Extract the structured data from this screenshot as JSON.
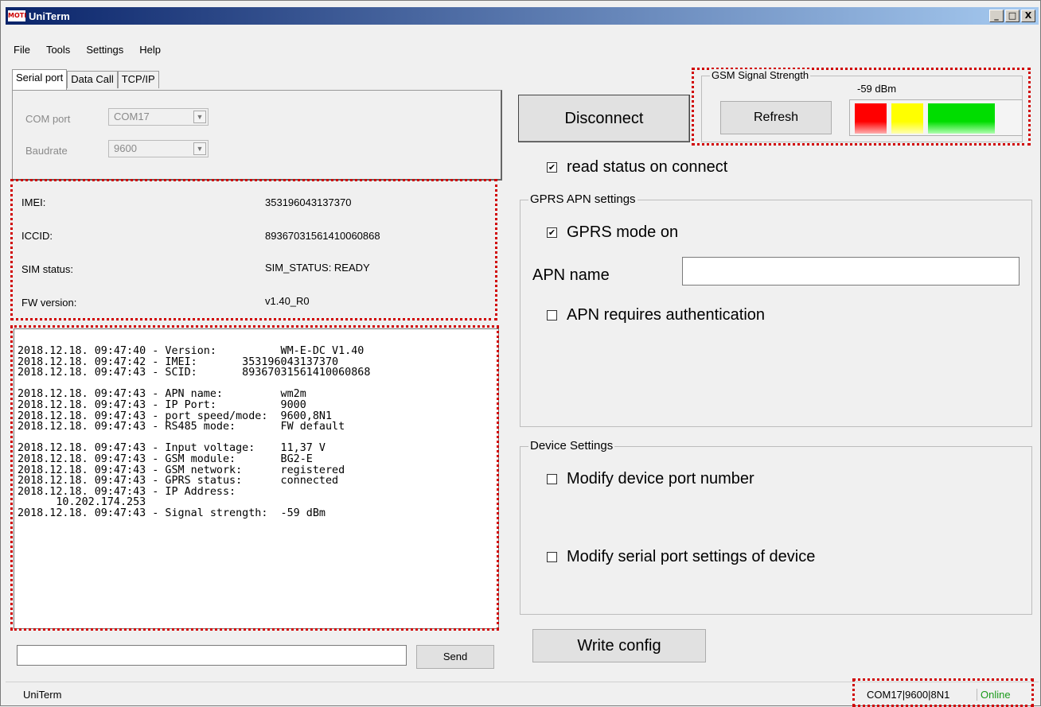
{
  "window": {
    "title": "UniTerm",
    "app_icon": "MOTI",
    "minimize": "_",
    "maximize": "□",
    "close": "X"
  },
  "menu": [
    "File",
    "Tools",
    "Settings",
    "Help"
  ],
  "tabs": [
    "Serial port",
    "Data Call",
    "TCP/IP"
  ],
  "serial": {
    "com_label": "COM port",
    "com_value": "COM17",
    "baud_label": "Baudrate",
    "baud_value": "9600"
  },
  "device_info": {
    "imei_label": "IMEI:",
    "imei": "353196043137370",
    "iccid_label": "ICCID:",
    "iccid": "89367031561410060868",
    "sim_label": "SIM status:",
    "sim": "SIM_STATUS: READY",
    "fw_label": "FW version:",
    "fw": "v1.40_R0"
  },
  "log_lines": [
    "2018.12.18. 09:47:40 - Version:          WM-E-DC V1.40",
    "2018.12.18. 09:47:42 - IMEI:       353196043137370",
    "2018.12.18. 09:47:43 - SCID:       89367031561410060868",
    "",
    "2018.12.18. 09:47:43 - APN name:         wm2m",
    "2018.12.18. 09:47:43 - IP Port:          9000",
    "2018.12.18. 09:47:43 - port speed/mode:  9600,8N1",
    "2018.12.18. 09:47:43 - RS485 mode:       FW default",
    "",
    "2018.12.18. 09:47:43 - Input voltage:    11,37 V",
    "2018.12.18. 09:47:43 - GSM module:       BG2-E",
    "2018.12.18. 09:47:43 - GSM network:      registered",
    "2018.12.18. 09:47:43 - GPRS status:      connected",
    "2018.12.18. 09:47:43 - IP Address:",
    "      10.202.174.253",
    "2018.12.18. 09:47:43 - Signal strength:  -59 dBm"
  ],
  "send_label": "Send",
  "disconnect_label": "Disconnect",
  "gsm": {
    "title": "GSM Signal Strength",
    "dbm": "-59 dBm",
    "refresh_label": "Refresh",
    "levels": [
      "#ff0000",
      "#ffff00",
      "#00cc00"
    ]
  },
  "read_status_label": "read status on connect",
  "gprs": {
    "title": "GPRS APN settings",
    "mode_label": "GPRS mode on",
    "apn_label": "APN name",
    "apn_value": "",
    "auth_label": "APN requires authentication"
  },
  "device_settings": {
    "title": "Device Settings",
    "port_label": "Modify device port number",
    "serial_label": "Modify serial port settings of device"
  },
  "write_config_label": "Write config",
  "status": {
    "app": "UniTerm",
    "port": "COM17|9600|8N1",
    "state": "Online"
  },
  "check_mark": "✔"
}
